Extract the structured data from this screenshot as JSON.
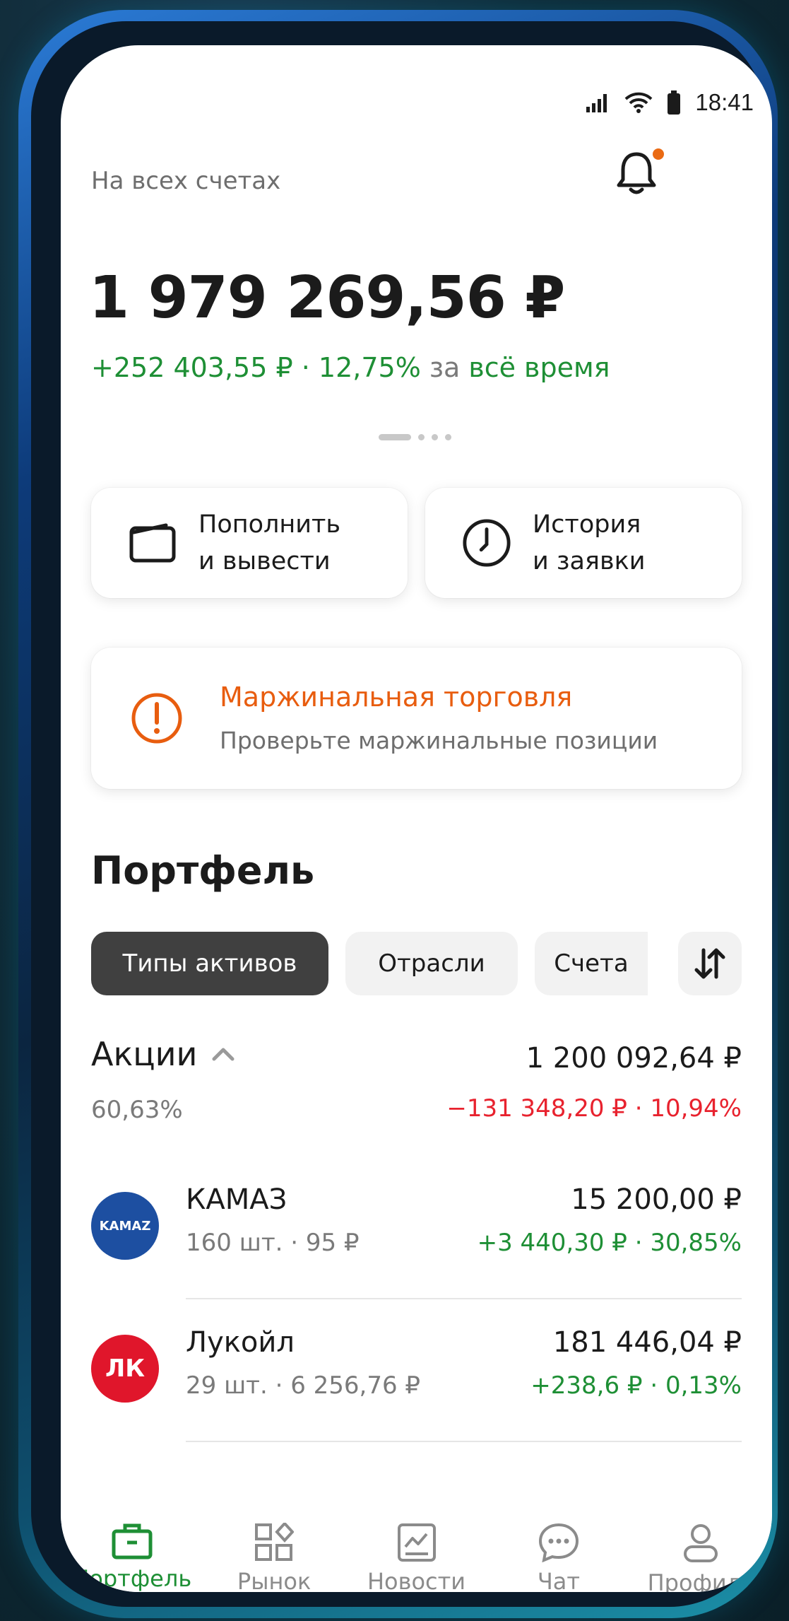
{
  "status_bar": {
    "time": "18:41"
  },
  "header": {
    "accounts_label": "На всех счетах"
  },
  "balance": {
    "total": "1 979 269,56 ₽",
    "change": "+252 403,55 ₽ · 12,75%",
    "period_prefix": "за",
    "period": "всё время"
  },
  "actions": [
    {
      "label_line1": "Пополнить",
      "label_line2": "и вывести",
      "icon": "wallet-icon"
    },
    {
      "label_line1": "История",
      "label_line2": "и заявки",
      "icon": "clock-icon"
    }
  ],
  "margin_alert": {
    "title": "Маржинальная торговля",
    "subtitle": "Проверьте маржинальные позиции",
    "icon": "warning-icon",
    "color": "#e85d0f"
  },
  "portfolio": {
    "title": "Портфель",
    "chips": [
      "Типы активов",
      "Отрасли",
      "Счета"
    ],
    "active_chip": "Типы активов",
    "group": {
      "name": "Акции",
      "percent": "60,63%",
      "total": "1 200 092,64 ₽",
      "change": "−131 348,20 ₽ · 10,94%"
    },
    "assets": [
      {
        "name": "КАМАЗ",
        "qty": "160 шт. · 95 ₽",
        "value": "15 200,00 ₽",
        "change": "+3 440,30 ₽ · 30,85%",
        "logo_text": "KAMAZ",
        "logo_color": "#1d4fa1"
      },
      {
        "name": "Лукойл",
        "qty": "29 шт. · 6 256,76 ₽",
        "value": "181 446,04 ₽",
        "change": "+238,6 ₽ · 0,13%",
        "logo_text": "ЛК",
        "logo_color": "#e0162b"
      }
    ]
  },
  "tabbar": [
    {
      "label": "Портфель",
      "icon": "briefcase-icon",
      "active": true
    },
    {
      "label": "Рынок",
      "icon": "grid-icon",
      "active": false
    },
    {
      "label": "Новости",
      "icon": "news-icon",
      "active": false
    },
    {
      "label": "Чат",
      "icon": "chat-icon",
      "active": false
    },
    {
      "label": "Профиль",
      "icon": "profile-icon",
      "active": false
    }
  ],
  "colors": {
    "accent_green": "#1e8f35",
    "negative_red": "#e8222e",
    "warning_orange": "#e85d0f"
  }
}
